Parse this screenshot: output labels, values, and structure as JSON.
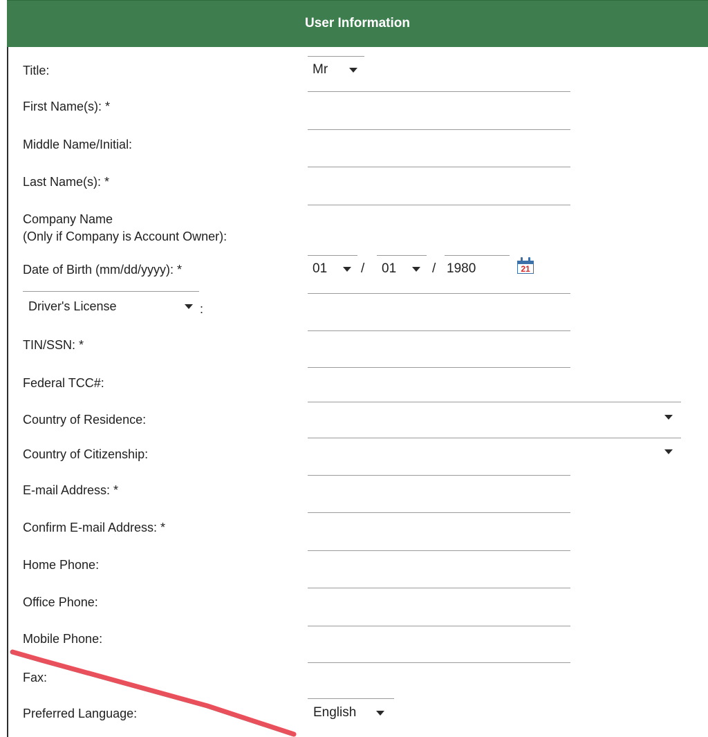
{
  "header": {
    "title": "User Information"
  },
  "form": {
    "title_label": "Title:",
    "title_value": "Mr",
    "first_name_label": "First Name(s): *",
    "middle_name_label": "Middle Name/Initial:",
    "last_name_label": "Last Name(s): *",
    "company_label_line1": "Company Name",
    "company_label_line2": "(Only if Company is Account Owner):",
    "dob_label": "Date of Birth (mm/dd/yyyy): *",
    "dob_month": "01",
    "dob_day": "01",
    "dob_year": "1980",
    "dob_separator": "/",
    "calendar_day": "21",
    "id_type_value": "Driver's License",
    "id_type_colon": ":",
    "tin_label": "TIN/SSN: *",
    "tcc_label": "Federal TCC#:",
    "residence_label": "Country of Residence:",
    "citizenship_label": "Country of Citizenship:",
    "email_label": "E-mail Address: *",
    "confirm_email_label": "Confirm E-mail Address: *",
    "home_phone_label": "Home Phone:",
    "office_phone_label": "Office Phone:",
    "mobile_phone_label": "Mobile Phone:",
    "fax_label": "Fax:",
    "language_label": "Preferred Language:",
    "language_value": "English"
  },
  "colors": {
    "header_bg": "#3d7d4e",
    "header_text": "#ffffff",
    "calendar_blue": "#3d6fa8",
    "calendar_red": "#d62828",
    "annotation_red": "#e8505b"
  },
  "icons": [
    "chevron-down-icon",
    "calendar-icon"
  ]
}
